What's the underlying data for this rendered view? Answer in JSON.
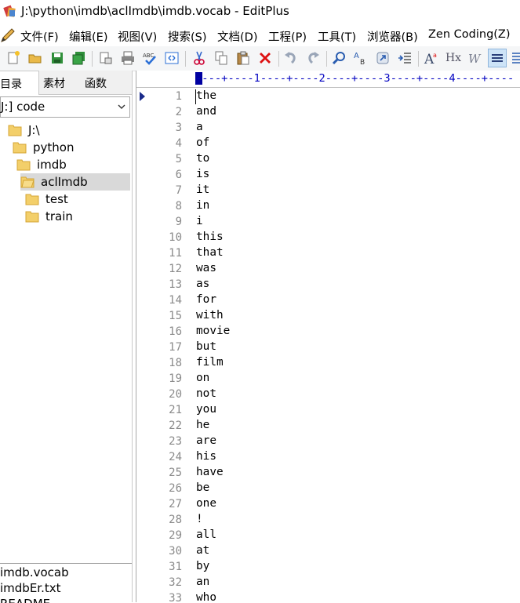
{
  "window": {
    "title": "J:\\python\\imdb\\aclImdb\\imdb.vocab - EditPlus"
  },
  "menu": [
    "文件(F)",
    "编辑(E)",
    "视图(V)",
    "搜索(S)",
    "文档(D)",
    "工程(P)",
    "工具(T)",
    "浏览器(B)",
    "Zen Coding(Z)"
  ],
  "toolbar": {
    "spell_label": "ABC",
    "hex_label": "Hx",
    "font_label": "A"
  },
  "sidebar": {
    "tabs": [
      "目录",
      "素材",
      "函数"
    ],
    "drive": "J:] code",
    "tree": [
      {
        "label": "J:\\"
      },
      {
        "label": "python"
      },
      {
        "label": "imdb"
      },
      {
        "label": "aclImdb"
      },
      {
        "label": "test"
      },
      {
        "label": "train"
      }
    ],
    "files": [
      "imdb.vocab",
      "imdbEr.txt",
      "README"
    ]
  },
  "editor": {
    "ruler": "----+----1----+----2----+----3----+----4----+----",
    "lines": [
      "the",
      "and",
      "a",
      "of",
      "to",
      "is",
      "it",
      "in",
      "i",
      "this",
      "that",
      "was",
      "as",
      "for",
      "with",
      "movie",
      "but",
      "film",
      "on",
      "not",
      "you",
      "he",
      "are",
      "his",
      "have",
      "be",
      "one",
      "!",
      "all",
      "at",
      "by",
      "an",
      "who"
    ]
  }
}
